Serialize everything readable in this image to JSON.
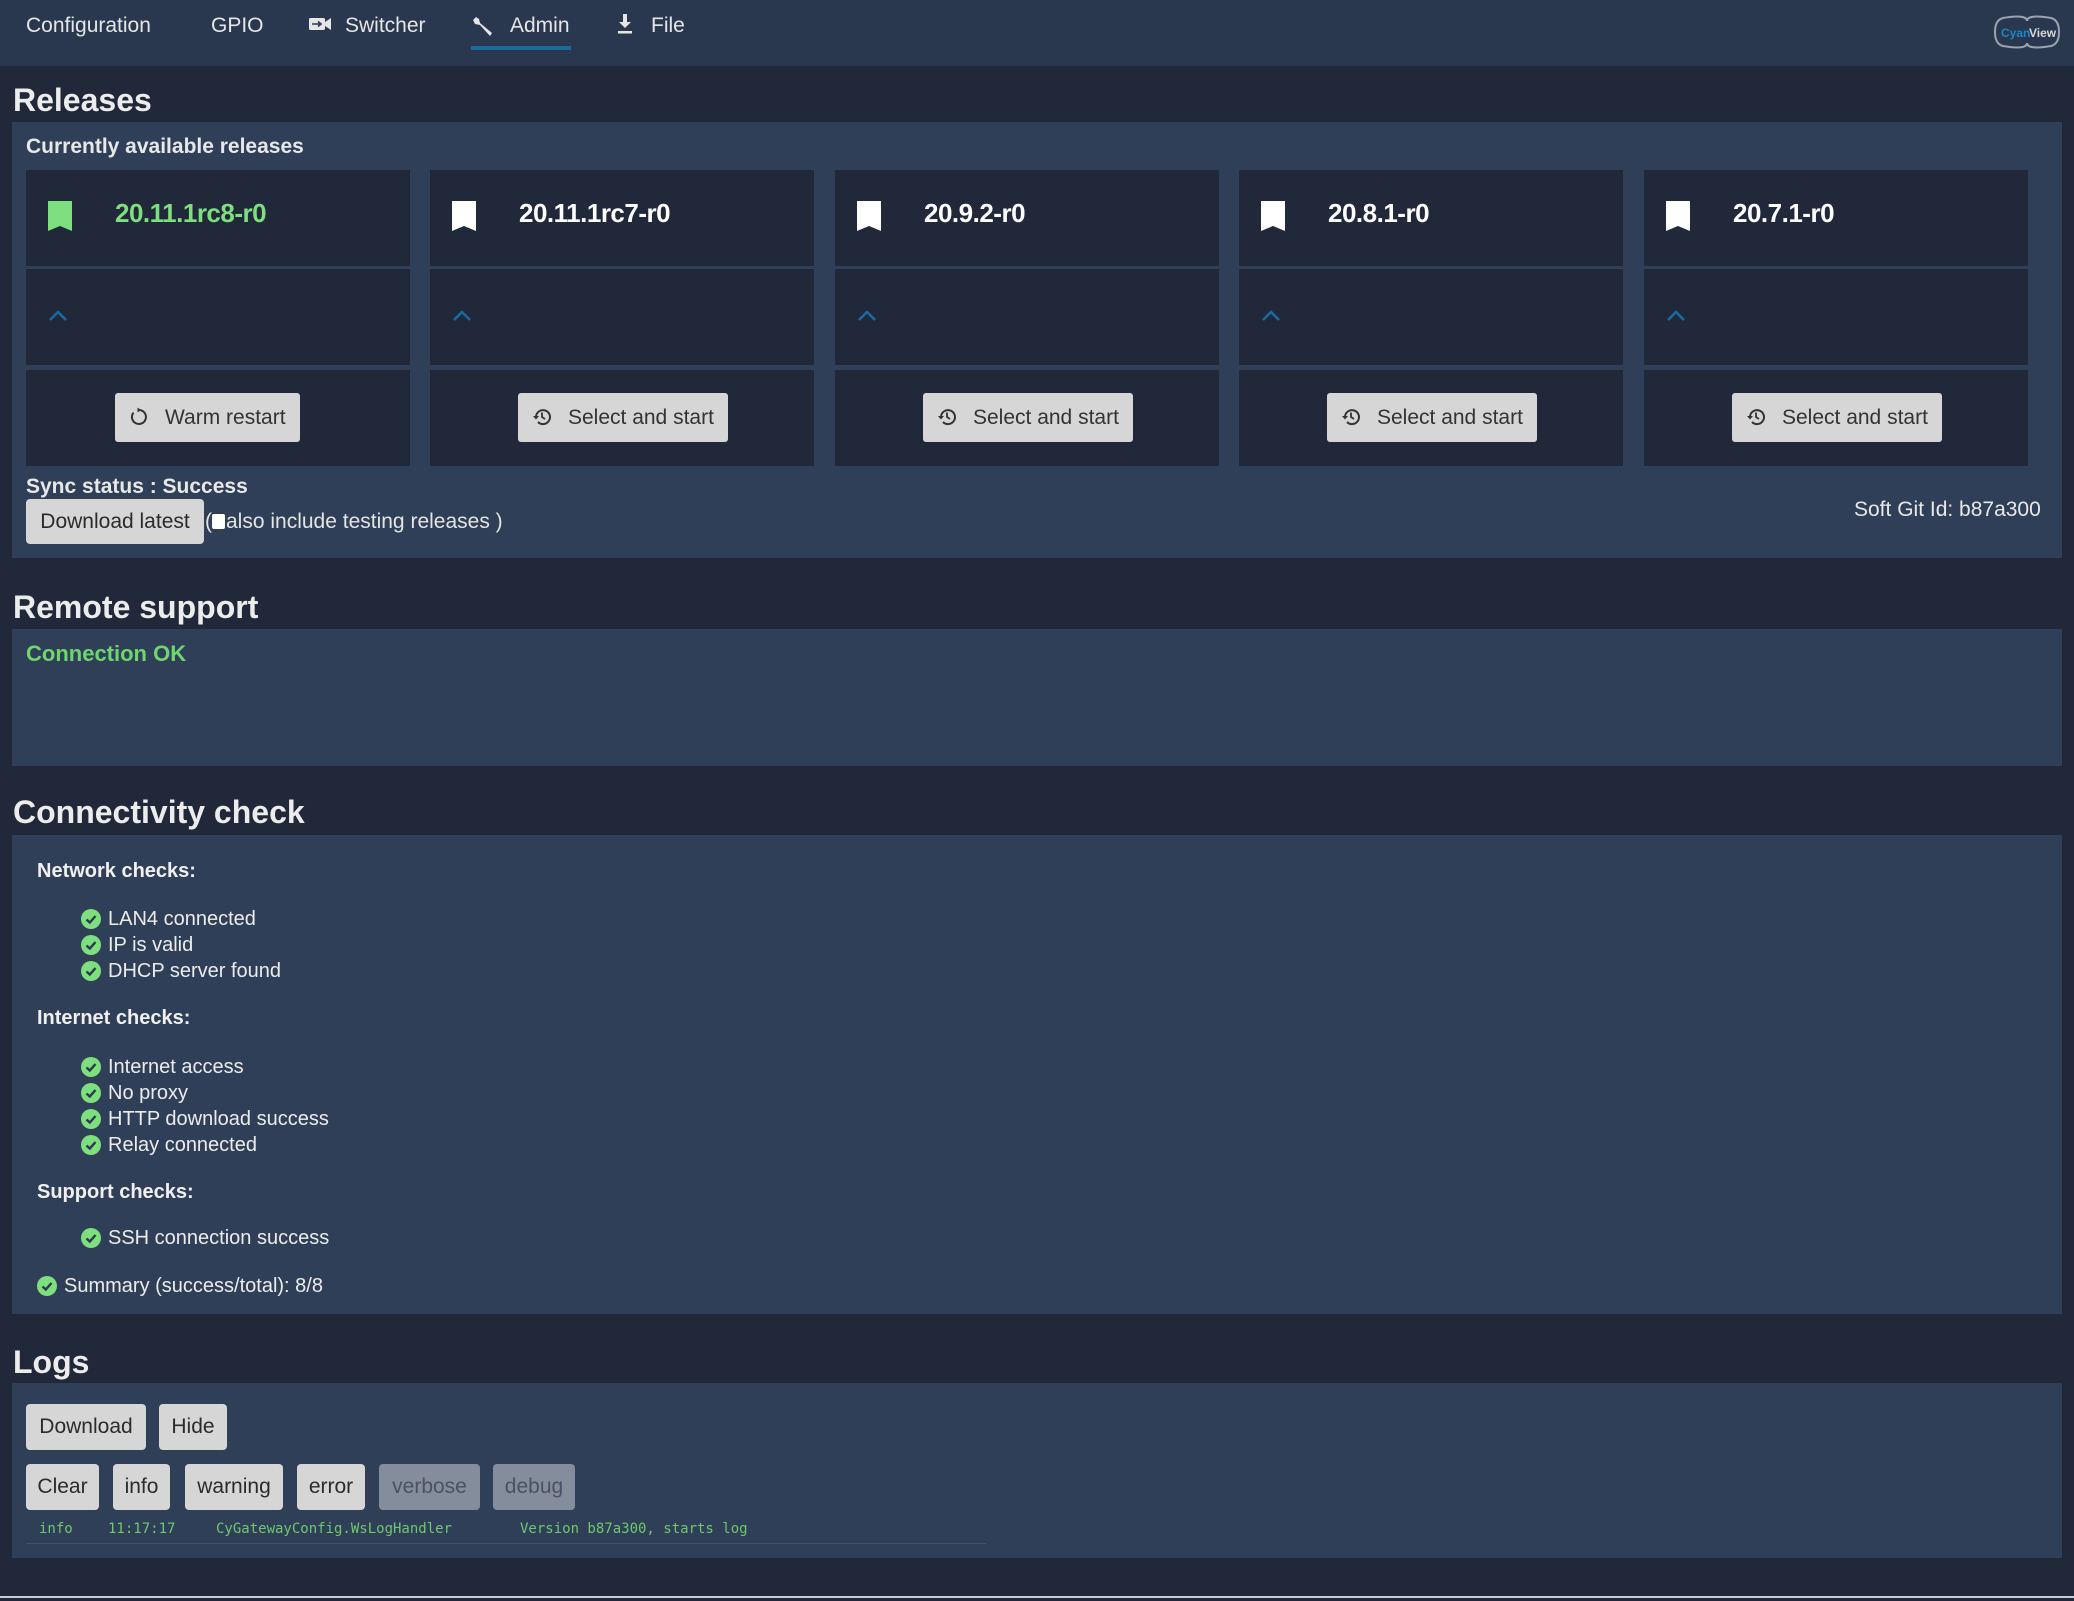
{
  "nav": {
    "items": [
      {
        "label": "Configuration",
        "icon": null
      },
      {
        "label": "GPIO",
        "icon": null
      },
      {
        "label": "Switcher",
        "icon": "video-camera-icon"
      },
      {
        "label": "Admin",
        "icon": "wrench-icon",
        "active": true
      },
      {
        "label": "File",
        "icon": "download-icon"
      }
    ],
    "logo": {
      "part1": "Cyan",
      "part2": "View"
    }
  },
  "colors": {
    "background": "#202839",
    "nav": "#29374f",
    "panel": "#2f3f57",
    "card": "#202839",
    "success": "#7ddf7d",
    "accent": "#1a6aa0",
    "button": "#d6d6d6"
  },
  "releases": {
    "title": "Releases",
    "subtitle": "Currently available releases",
    "cards": [
      {
        "version": "20.11.1rc8-r0",
        "current": true,
        "action": "Warm restart",
        "action_icon": "restart-icon"
      },
      {
        "version": "20.11.1rc7-r0",
        "current": false,
        "action": "Select and start",
        "action_icon": "history-icon"
      },
      {
        "version": "20.9.2-r0",
        "current": false,
        "action": "Select and start",
        "action_icon": "history-icon"
      },
      {
        "version": "20.8.1-r0",
        "current": false,
        "action": "Select and start",
        "action_icon": "history-icon"
      },
      {
        "version": "20.7.1-r0",
        "current": false,
        "action": "Select and start",
        "action_icon": "history-icon"
      }
    ],
    "sync_status": "Sync status : Success",
    "download_latest": "Download latest",
    "include_testing_prefix": "(",
    "include_testing_label": "also include testing releases )",
    "include_testing_checked": false,
    "soft_git_id": "Soft Git Id: b87a300"
  },
  "remote_support": {
    "title": "Remote support",
    "status": "Connection OK"
  },
  "connectivity": {
    "title": "Connectivity check",
    "groups": [
      {
        "label": "Network checks:",
        "items": [
          "LAN4 connected",
          "IP is valid",
          "DHCP server found"
        ]
      },
      {
        "label": "Internet checks:",
        "items": [
          "Internet access",
          "No proxy",
          "HTTP download success",
          "Relay connected"
        ]
      },
      {
        "label": "Support checks:",
        "items": [
          "SSH connection success"
        ]
      }
    ],
    "summary": "Summary (success/total): 8/8"
  },
  "logs": {
    "title": "Logs",
    "download": "Download",
    "hide": "Hide",
    "filters": [
      {
        "label": "Clear",
        "enabled": true
      },
      {
        "label": "info",
        "enabled": true
      },
      {
        "label": "warning",
        "enabled": true
      },
      {
        "label": "error",
        "enabled": true
      },
      {
        "label": "verbose",
        "enabled": false
      },
      {
        "label": "debug",
        "enabled": false
      }
    ],
    "entries": [
      {
        "level": "info",
        "time": "11:17:17",
        "source": "CyGatewayConfig.WsLogHandler",
        "message": "Version b87a300, starts log"
      }
    ]
  }
}
